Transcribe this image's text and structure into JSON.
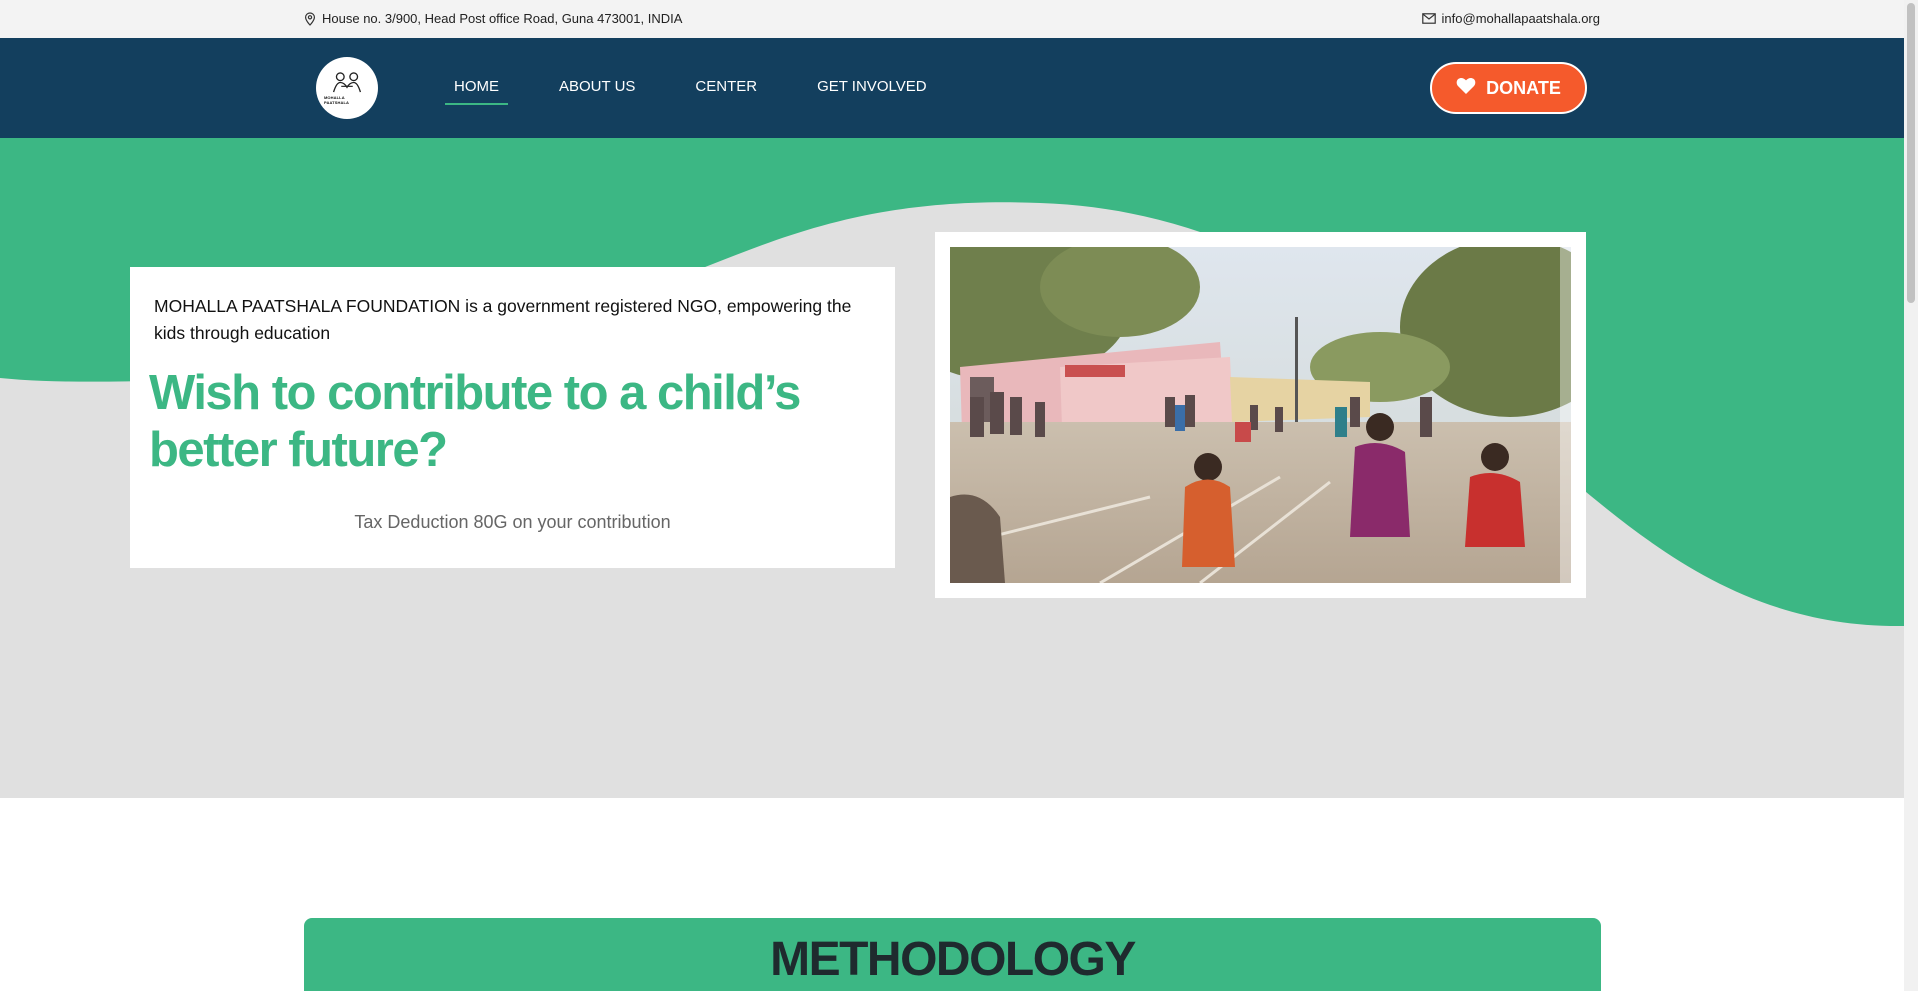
{
  "topbar": {
    "address": "House no. 3/900, Head Post office Road, Guna 473001, INDIA",
    "email": "info@mohallapaatshala.org"
  },
  "logo": {
    "text": "MOHALLA PAATSHALA"
  },
  "nav": {
    "items": [
      {
        "label": "HOME",
        "active": true
      },
      {
        "label": "ABOUT US",
        "active": false
      },
      {
        "label": "CENTER",
        "active": false
      },
      {
        "label": "GET INVOLVED",
        "active": false
      }
    ],
    "donate_label": "DONATE"
  },
  "hero": {
    "intro": "MOHALLA PAATSHALA FOUNDATION is a government registered NGO, empowering the kids through education",
    "headline": "Wish to contribute to a child’s better future?",
    "tax_note": "Tax Deduction 80G on your contribution"
  },
  "methodology": {
    "title": "METHODOLOGY"
  },
  "colors": {
    "topbar_bg": "#f3f3f3",
    "nav_bg": "#133f5e",
    "accent_green": "#3cb784",
    "donate_orange": "#f55a2c",
    "hero_gray": "#e0e0e0"
  }
}
